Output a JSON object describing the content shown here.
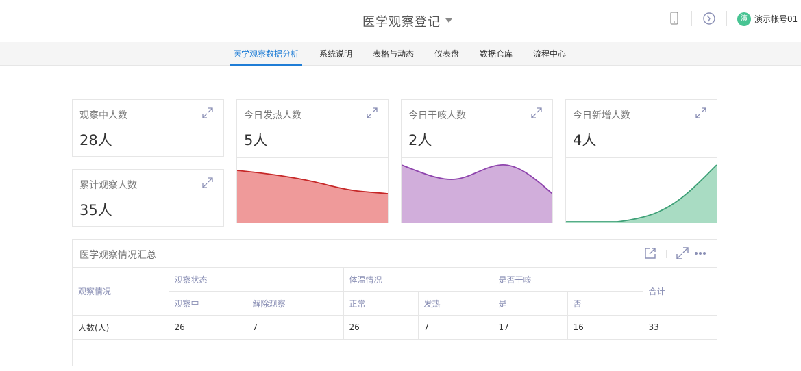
{
  "header": {
    "title": "医学观察登记",
    "user": {
      "avatar_char": "演",
      "name": "演示帐号01"
    },
    "icons": [
      "mobile-icon",
      "compass-icon"
    ]
  },
  "nav": {
    "tabs": [
      {
        "label": "医学观察数据分析",
        "active": true
      },
      {
        "label": "系统说明"
      },
      {
        "label": "表格与动态"
      },
      {
        "label": "仪表盘"
      },
      {
        "label": "数据仓库"
      },
      {
        "label": "流程中心"
      }
    ]
  },
  "stats": {
    "observing": {
      "label": "观察中人数",
      "value": "28人"
    },
    "total": {
      "label": "累计观察人数",
      "value": "35人"
    },
    "fever": {
      "label": "今日发热人数",
      "value": "5人",
      "color": "#c62828",
      "fill": "#ef9a9a"
    },
    "cough": {
      "label": "今日干咳人数",
      "value": "2人",
      "color": "#8e44ad",
      "fill": "#d1aedb"
    },
    "new": {
      "label": "今日新增人数",
      "value": "4人",
      "color": "#3ea077",
      "fill": "#a9dcc3"
    }
  },
  "summary": {
    "title": "医学观察情况汇总",
    "headers": {
      "row_label": "观察情况",
      "observe_status": "观察状态",
      "temperature": "体温情况",
      "cough": "是否干咳",
      "total": "合计",
      "observing": "观察中",
      "released": "解除观察",
      "normal": "正常",
      "fever": "发热",
      "yes": "是",
      "no": "否"
    },
    "row": {
      "label": "人数(人)",
      "observing": "26",
      "released": "7",
      "normal": "26",
      "fever": "7",
      "yes": "17",
      "no": "16",
      "total": "33"
    }
  },
  "colors": {
    "accent": "#1f7dd6",
    "header_text": "#8a8fb5"
  }
}
